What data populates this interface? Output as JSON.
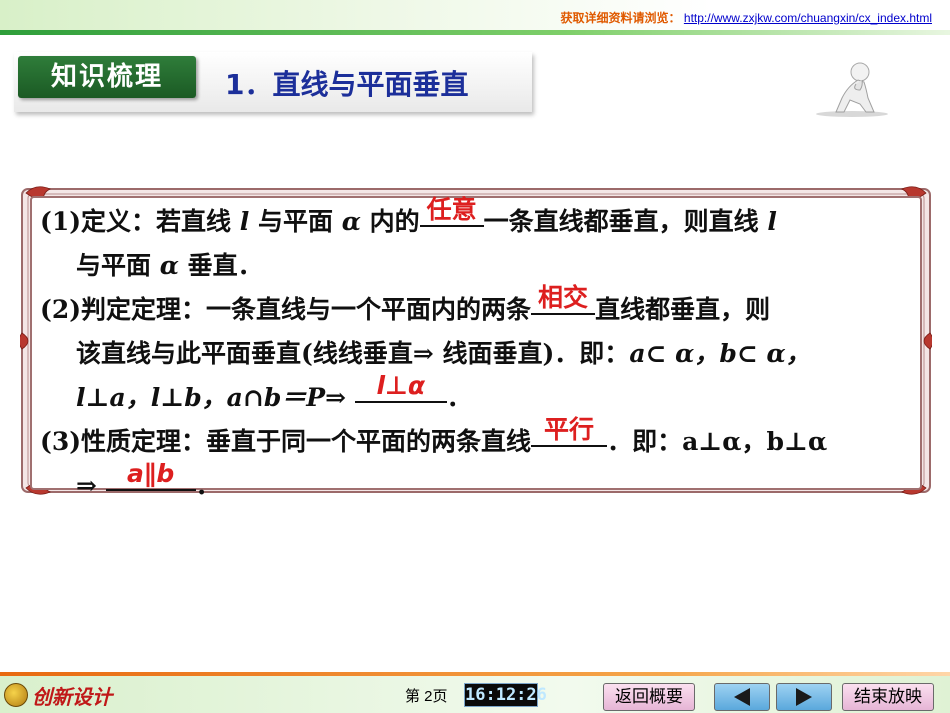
{
  "top_bar": {
    "label": "获取详细资料请浏览：",
    "url": "http://www.zxjkw.com/chuangxin/cx_index.html"
  },
  "header": {
    "badge": "知识梳理",
    "title": "1．直线与平面垂直"
  },
  "content": {
    "item1": {
      "a": "(1)定义：若直线 ",
      "l": "l",
      "b": " 与平面 ",
      "alpha": "α",
      "c": " 内的",
      "answer": "任意",
      "d": "一条直线都垂直，则直线 ",
      "l2": "l",
      "e": "与平面 ",
      "alpha2": "α",
      "f": " 垂直．"
    },
    "item2": {
      "a": "(2)判定定理：一条直线与一个平面内的两条",
      "answer1": "相交",
      "b": "直线都垂直，则",
      "c": "该直线与此平面垂直(线线垂直⇒ 线面垂直)．即：",
      "d": "a⊂ α，b⊂ α，",
      "e": "l⊥a，l⊥b，a∩b＝P⇒ ",
      "answer2": "l⊥α",
      "f": "．"
    },
    "item3": {
      "a": "(3)性质定理：垂直于同一个平面的两条直线",
      "answer1": "平行",
      "b": "．即：a⊥α，b⊥α",
      "c": "⇒ ",
      "answer2": "a∥b",
      "d": "．"
    }
  },
  "footer": {
    "logo_text": "创新设计",
    "page": "第 2页",
    "clock": "16:12:26",
    "back_label": "返回概要",
    "end_label": "结束放映"
  },
  "colors": {
    "title": "#1c2f9a",
    "answer": "#dd1f1f",
    "badge": "#2f7d3a"
  }
}
